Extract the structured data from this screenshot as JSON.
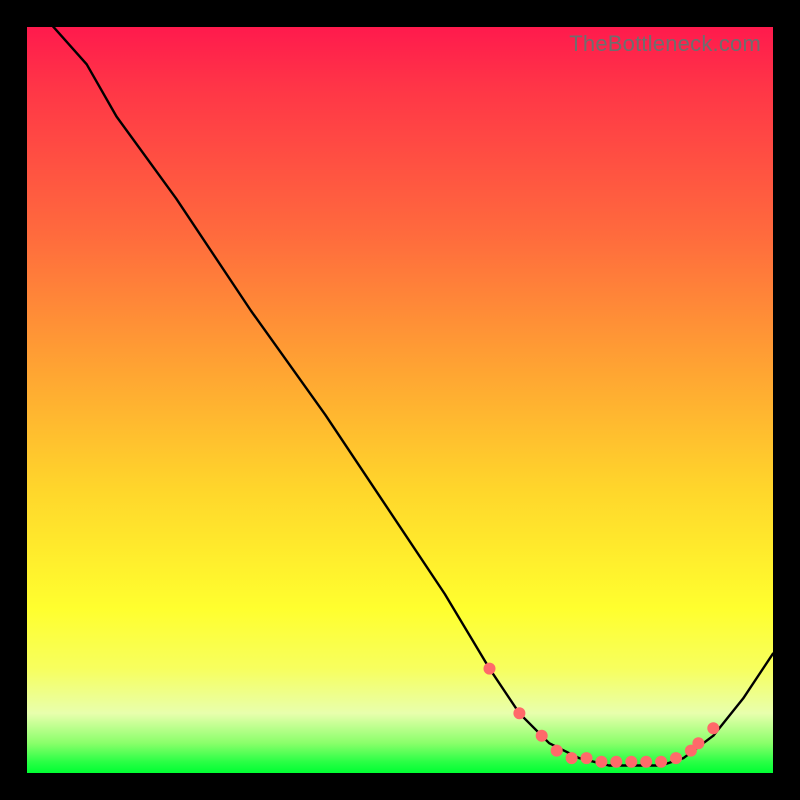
{
  "watermark": "TheBottleneck.com",
  "chart_data": {
    "type": "line",
    "title": "",
    "xlabel": "",
    "ylabel": "",
    "xlim": [
      0,
      100
    ],
    "ylim": [
      0,
      100
    ],
    "series": [
      {
        "name": "bottleneck-curve",
        "x": [
          0,
          8,
          12,
          20,
          30,
          40,
          50,
          56,
          62,
          66,
          70,
          74,
          78,
          82,
          85,
          88,
          92,
          96,
          100
        ],
        "values": [
          104,
          95,
          88,
          77,
          62,
          48,
          33,
          24,
          14,
          8,
          4,
          2,
          1,
          1,
          1,
          2,
          5,
          10,
          16
        ]
      }
    ],
    "markers": {
      "name": "highlight-dots",
      "x": [
        62,
        66,
        69,
        71,
        73,
        75,
        77,
        79,
        81,
        83,
        85,
        87,
        89,
        90,
        92
      ],
      "values": [
        14,
        8,
        5,
        3,
        2,
        2,
        1.5,
        1.5,
        1.5,
        1.5,
        1.5,
        2,
        3,
        4,
        6
      ],
      "color": "#ff6a6a",
      "radius": 6
    },
    "gradient_stops": [
      {
        "pos": 0,
        "color": "#ff1a4d"
      },
      {
        "pos": 0.28,
        "color": "#ff6b3d"
      },
      {
        "pos": 0.62,
        "color": "#ffd62b"
      },
      {
        "pos": 0.86,
        "color": "#f7ff5e"
      },
      {
        "pos": 0.96,
        "color": "#8aff6a"
      },
      {
        "pos": 1.0,
        "color": "#00ff33"
      }
    ]
  }
}
